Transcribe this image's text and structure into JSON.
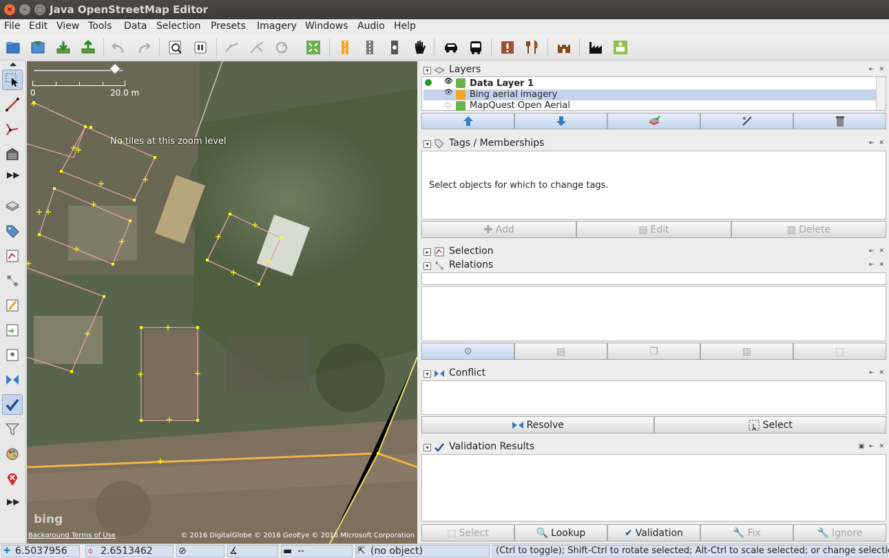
{
  "window": {
    "title": "Java OpenStreetMap Editor"
  },
  "menu": [
    "File",
    "Edit",
    "View",
    "Tools",
    "Data",
    "Selection",
    "Presets",
    "Imagery",
    "Windows",
    "Audio",
    "Help"
  ],
  "map": {
    "scale_start": "0",
    "scale_label": "20.0 m",
    "no_tiles": "No tiles at this zoom level",
    "bing_logo": "bing",
    "terms": "Background Terms of Use",
    "attribution": "© 2016 DigitalGlobe © 2016 GeoEye © 2016 Microsoft Corporation"
  },
  "layers_panel": {
    "title": "Layers",
    "layers": [
      {
        "name": "Data Layer 1",
        "active": true
      },
      {
        "name": "Bing aerial imagery",
        "selected": true
      },
      {
        "name": "MapQuest Open Aerial"
      }
    ]
  },
  "tags_panel": {
    "title": "Tags / Memberships",
    "message": "Select objects for which to change tags.",
    "add": "Add",
    "edit": "Edit",
    "delete": "Delete"
  },
  "selection_panel": {
    "title": "Selection"
  },
  "relations_panel": {
    "title": "Relations"
  },
  "conflict_panel": {
    "title": "Conflict",
    "resolve": "Resolve",
    "select": "Select"
  },
  "validation_panel": {
    "title": "Validation Results",
    "select": "Select",
    "lookup": "Lookup",
    "validation": "Validation",
    "fix": "Fix",
    "ignore": "Ignore"
  },
  "status": {
    "lat": "6.5037956",
    "lon": "2.6513462",
    "length": "--",
    "object": "(no object)",
    "hint": "(Ctrl to toggle); Shift-Ctrl to rotate selected; Alt-Ctrl to scale selected; or change selection"
  },
  "colors": {
    "building": "#e8a0a8",
    "road": "#f5b04a",
    "path": "#f0e070",
    "node": "#ffff00",
    "selection_blue": "#c4d4ea"
  }
}
